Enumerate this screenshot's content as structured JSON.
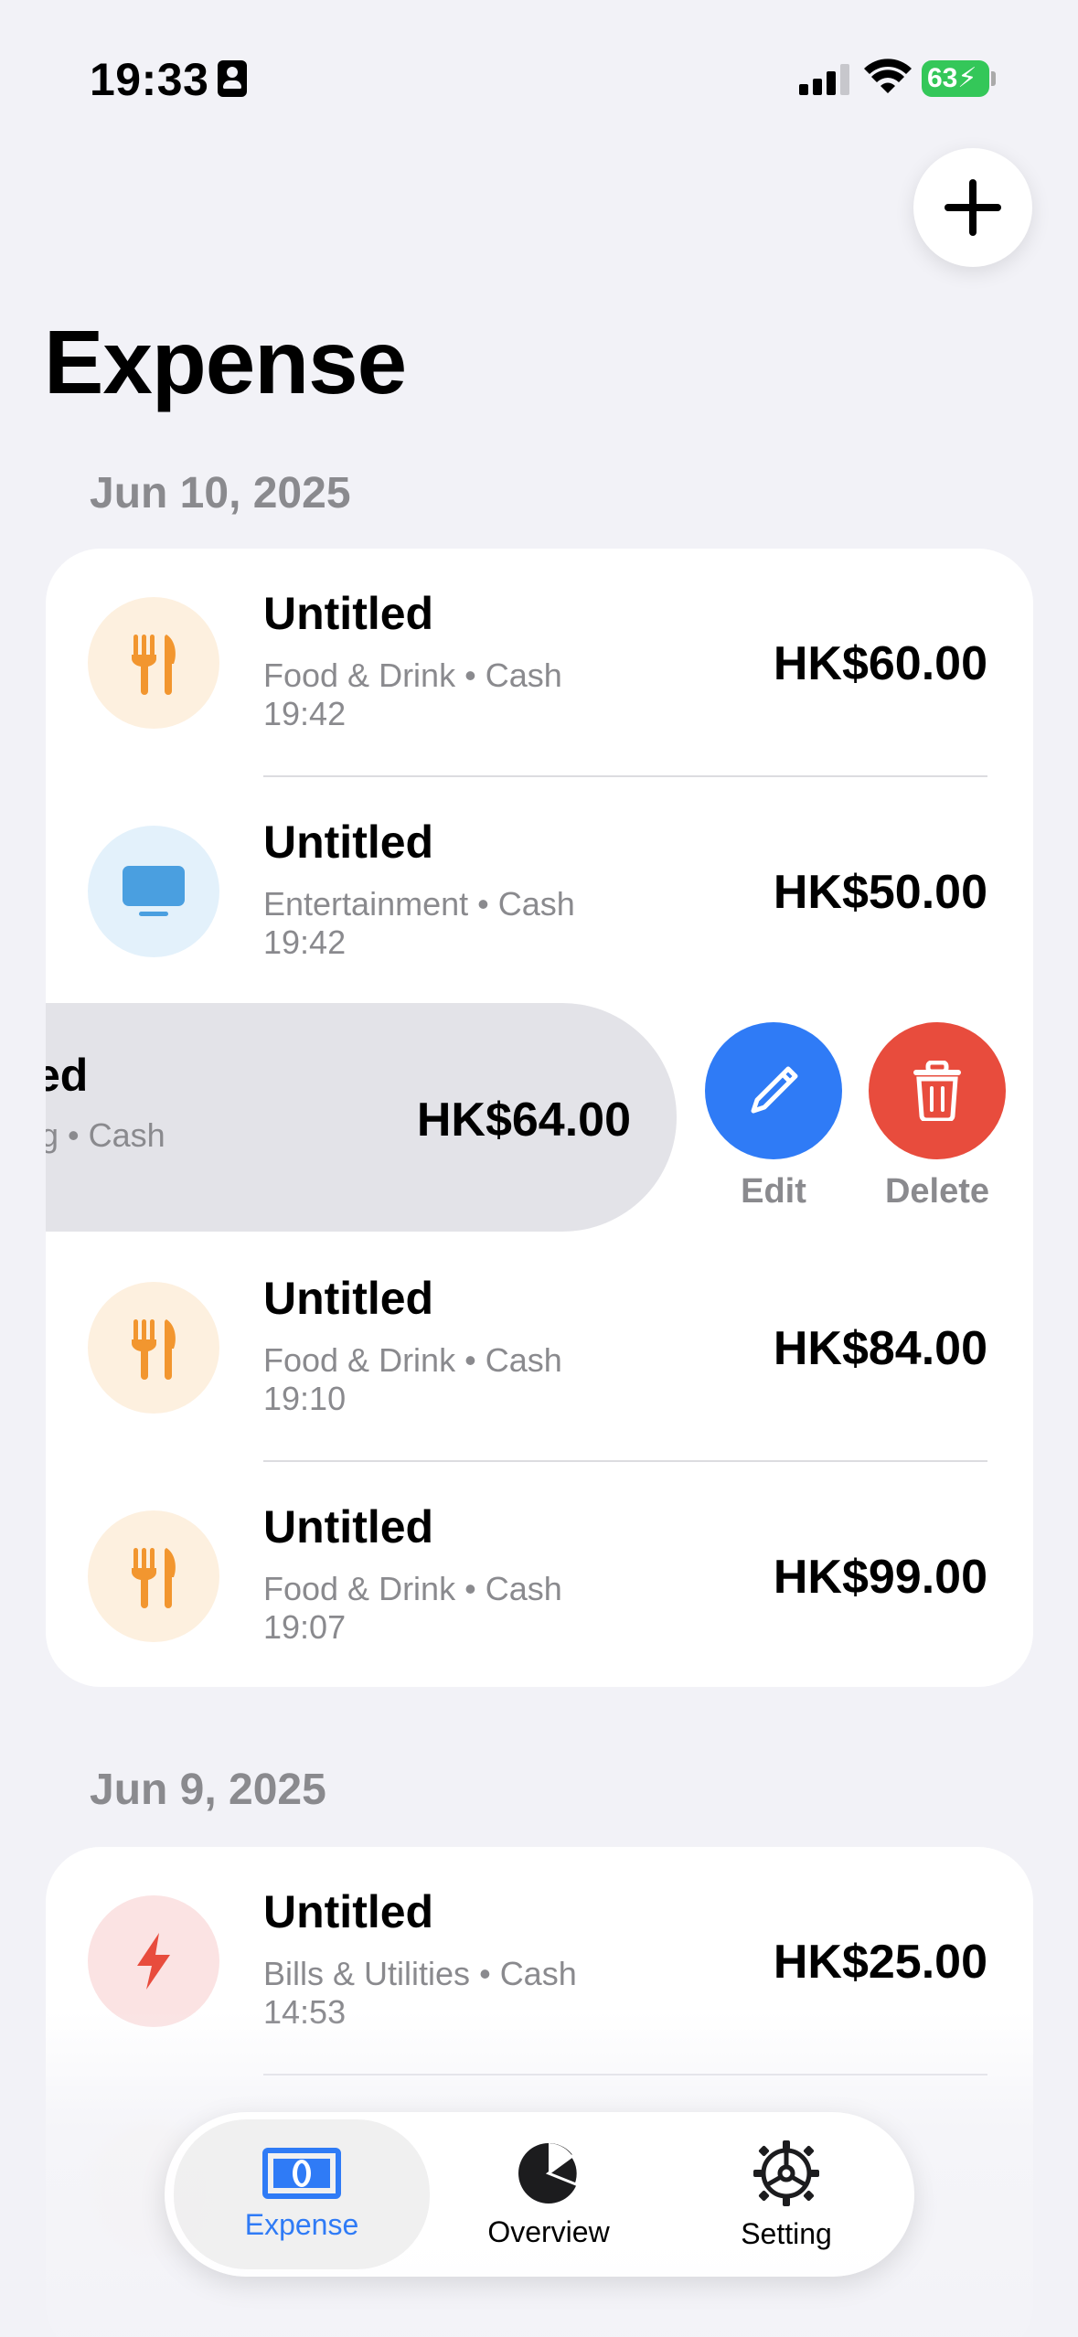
{
  "status_bar": {
    "time": "19:33",
    "battery": "63"
  },
  "page": {
    "title": "Expense"
  },
  "sections": [
    {
      "date": "Jun 10, 2025",
      "rows": [
        {
          "title": "Untitled",
          "category": "Food & Drink",
          "method": "Cash",
          "time": "19:42",
          "amount": "HK$60.00",
          "icon": "fork-knife-icon"
        },
        {
          "title": "Untitled",
          "category": "Entertainment",
          "method": "Cash",
          "time": "19:42",
          "amount": "HK$50.00",
          "icon": "tv-icon"
        },
        {
          "title": "ed",
          "subtitle": "g • Cash",
          "amount": "HK$64.00"
        },
        {
          "title": "Untitled",
          "category": "Food & Drink",
          "method": "Cash",
          "time": "19:10",
          "amount": "HK$84.00",
          "icon": "fork-knife-icon"
        },
        {
          "title": "Untitled",
          "category": "Food & Drink",
          "method": "Cash",
          "time": "19:07",
          "amount": "HK$99.00",
          "icon": "fork-knife-icon"
        }
      ]
    },
    {
      "date": "Jun 9, 2025",
      "rows": [
        {
          "title": "Untitled",
          "category": "Bills & Utilities",
          "method": "Cash",
          "time": "14:53",
          "amount": "HK$25.00",
          "icon": "bolt-icon"
        }
      ]
    }
  ],
  "swipe_actions": {
    "edit": "Edit",
    "delete": "Delete"
  },
  "tab_bar": {
    "tabs": [
      {
        "label": "Expense",
        "icon": "banknote-icon",
        "active": true
      },
      {
        "label": "Overview",
        "icon": "pie-chart-icon",
        "active": false
      },
      {
        "label": "Setting",
        "icon": "gear-icon",
        "active": false
      }
    ]
  },
  "colors": {
    "accent": "#2f7bf6",
    "delete": "#e84c3d",
    "food": "#f2962f",
    "entertainment": "#4a9fe0",
    "bills": "#e84c3d"
  }
}
